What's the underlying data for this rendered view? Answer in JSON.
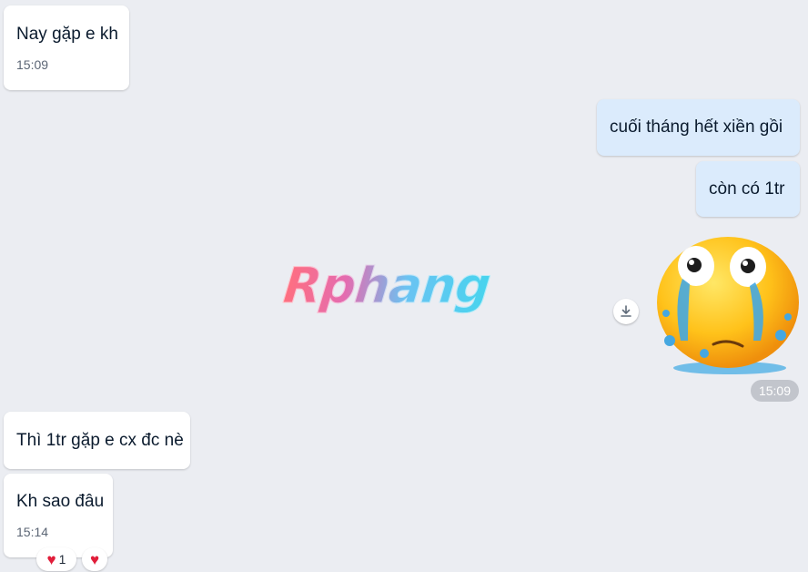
{
  "messages": [
    {
      "text": "Nay gặp e kh",
      "time": "15:09"
    },
    {
      "text": "cuối tháng hết xiền gồi"
    },
    {
      "text": "còn có 1tr"
    },
    {
      "time": "15:09"
    },
    {
      "text": "Thì 1tr gặp e cx đc nè"
    },
    {
      "text": "Kh sao đâu",
      "time": "15:14"
    }
  ],
  "watermark": "Rphang",
  "sticker": {
    "name": "crying-face-sticker"
  },
  "icons": {
    "download": "download-icon",
    "reaction": "heart-icon"
  },
  "reactions": {
    "count": "1"
  },
  "colors": {
    "background": "#ebedf2",
    "incoming": "#ffffff",
    "outgoing": "#dbebfc",
    "heart": "#e11d3a"
  }
}
